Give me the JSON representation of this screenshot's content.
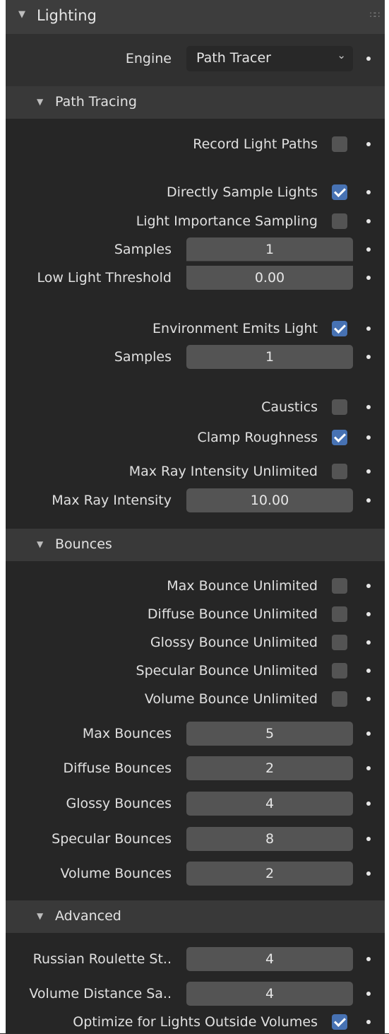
{
  "panel": {
    "title": "Lighting"
  },
  "engine": {
    "label": "Engine",
    "value": "Path Tracer"
  },
  "path_tracing": {
    "title": "Path Tracing",
    "record_light_paths": {
      "label": "Record Light Paths",
      "checked": false
    },
    "directly_sample_lights": {
      "label": "Directly Sample Lights",
      "checked": true
    },
    "light_importance_sampling": {
      "label": "Light Importance Sampling",
      "checked": false
    },
    "samples": {
      "label": "Samples",
      "value": "1"
    },
    "low_light_threshold": {
      "label": "Low Light Threshold",
      "value": "0.00"
    },
    "environment_emits_light": {
      "label": "Environment Emits Light",
      "checked": true
    },
    "env_samples": {
      "label": "Samples",
      "value": "1"
    },
    "caustics": {
      "label": "Caustics",
      "checked": false
    },
    "clamp_roughness": {
      "label": "Clamp Roughness",
      "checked": true
    },
    "max_ray_intensity_unlimited": {
      "label": "Max Ray Intensity Unlimited",
      "checked": false
    },
    "max_ray_intensity": {
      "label": "Max Ray Intensity",
      "value": "10.00"
    }
  },
  "bounces": {
    "title": "Bounces",
    "max_bounce_unlimited": {
      "label": "Max Bounce Unlimited",
      "checked": false
    },
    "diffuse_bounce_unlimited": {
      "label": "Diffuse Bounce Unlimited",
      "checked": false
    },
    "glossy_bounce_unlimited": {
      "label": "Glossy Bounce Unlimited",
      "checked": false
    },
    "specular_bounce_unlimited": {
      "label": "Specular Bounce Unlimited",
      "checked": false
    },
    "volume_bounce_unlimited": {
      "label": "Volume Bounce Unlimited",
      "checked": false
    },
    "max_bounces": {
      "label": "Max Bounces",
      "value": "5"
    },
    "diffuse_bounces": {
      "label": "Diffuse Bounces",
      "value": "2"
    },
    "glossy_bounces": {
      "label": "Glossy Bounces",
      "value": "4"
    },
    "specular_bounces": {
      "label": "Specular Bounces",
      "value": "8"
    },
    "volume_bounces": {
      "label": "Volume Bounces",
      "value": "2"
    }
  },
  "advanced": {
    "title": "Advanced",
    "russian_roulette": {
      "label": "Russian Roulette St..",
      "value": "4"
    },
    "volume_distance": {
      "label": "Volume Distance Sa..",
      "value": "4"
    },
    "optimize_lights": {
      "label": "Optimize for Lights Outside Volumes",
      "checked": true
    }
  },
  "colors": {
    "accent": "#4772b3",
    "field": "#545454",
    "panel_bg": "#262626",
    "header_bg": "#3d3d3d"
  }
}
